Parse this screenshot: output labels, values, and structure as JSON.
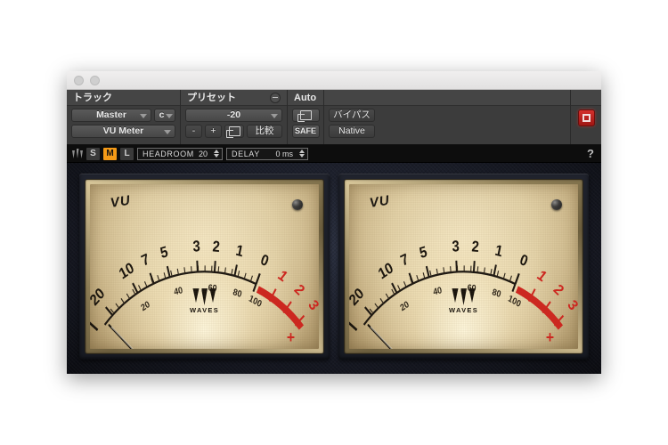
{
  "window": {
    "buttons": [
      "close",
      "minimize"
    ]
  },
  "host_toolbar": {
    "track": {
      "header": "トラック",
      "name_value": "Master",
      "channel_value": "c",
      "plugin_value": "VU Meter"
    },
    "preset": {
      "header": "プリセット",
      "value": "-20",
      "prev_label": "-",
      "next_label": "+",
      "copy_icon": "copy-icon",
      "compare_label": "比較"
    },
    "auto": {
      "header": "Auto",
      "auto_icon": "automation-icon",
      "safe_label": "SAFE"
    },
    "mode": {
      "bypass_label": "バイパス",
      "native_label": "Native"
    },
    "indicator": {
      "icon": "red-square-icon"
    }
  },
  "plugin_bar": {
    "logo": "waves-logo",
    "size_buttons": [
      {
        "label": "S",
        "active": false
      },
      {
        "label": "M",
        "active": true
      },
      {
        "label": "L",
        "active": false
      }
    ],
    "headroom": {
      "label": "HEADROOM",
      "value": "20"
    },
    "delay": {
      "label": "DELAY",
      "value": "0 ms"
    },
    "help_label": "?"
  },
  "meters": [
    {
      "title": "VU",
      "brand": "WAVES",
      "led_state": "off",
      "needle_value": -20,
      "upper_scale": [
        "20",
        "10",
        "7",
        "5",
        "3",
        "2",
        "1",
        "0"
      ],
      "upper_scale_red": [
        "1",
        "2",
        "3"
      ],
      "plus_mark": "+",
      "lower_scale": [
        "20",
        "40",
        "60",
        "80",
        "100"
      ],
      "red_zone_color": "#d0251f",
      "face_color": "#e6d5ab"
    },
    {
      "title": "VU",
      "brand": "WAVES",
      "led_state": "off",
      "needle_value": -20,
      "upper_scale": [
        "20",
        "10",
        "7",
        "5",
        "3",
        "2",
        "1",
        "0"
      ],
      "upper_scale_red": [
        "1",
        "2",
        "3"
      ],
      "plus_mark": "+",
      "lower_scale": [
        "20",
        "40",
        "60",
        "80",
        "100"
      ],
      "red_zone_color": "#d0251f",
      "face_color": "#e6d5ab"
    }
  ]
}
